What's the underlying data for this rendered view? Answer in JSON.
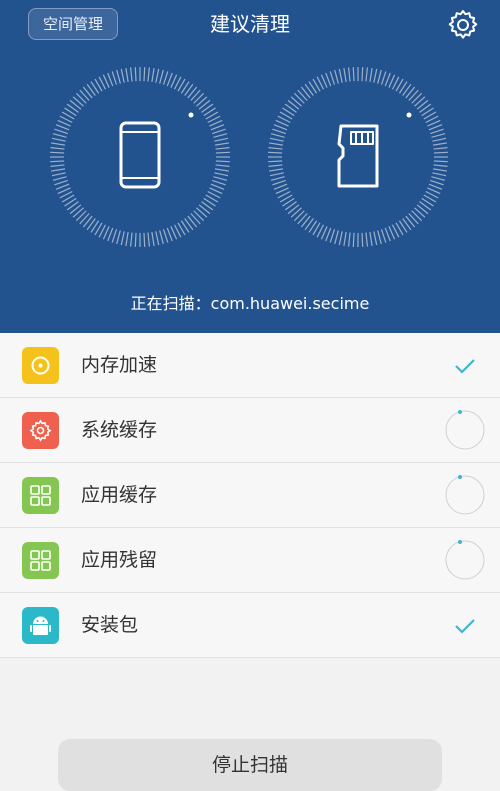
{
  "header": {
    "space_button_label": "空间管理",
    "title": "建议清理",
    "settings_icon": "gear-icon",
    "scan_status": "正在扫描：com.huawei.secime",
    "background_color": "#23538f"
  },
  "dials": [
    {
      "icon": "phone-icon"
    },
    {
      "icon": "sd-card-icon"
    }
  ],
  "items": [
    {
      "label": "内存加速",
      "icon": "memory-boost-icon",
      "icon_color": "#f5c21b",
      "status": "done"
    },
    {
      "label": "系统缓存",
      "icon": "system-cache-icon",
      "icon_color": "#f0604e",
      "status": "scanning"
    },
    {
      "label": "应用缓存",
      "icon": "app-cache-icon",
      "icon_color": "#85c552",
      "status": "scanning"
    },
    {
      "label": "应用残留",
      "icon": "app-residue-icon",
      "icon_color": "#85c552",
      "status": "scanning"
    },
    {
      "label": "安装包",
      "icon": "install-package-icon",
      "icon_color": "#2bb8c8",
      "status": "done"
    }
  ],
  "footer": {
    "stop_button_label": "停止扫描"
  },
  "accent_color": "#3fb6cf"
}
